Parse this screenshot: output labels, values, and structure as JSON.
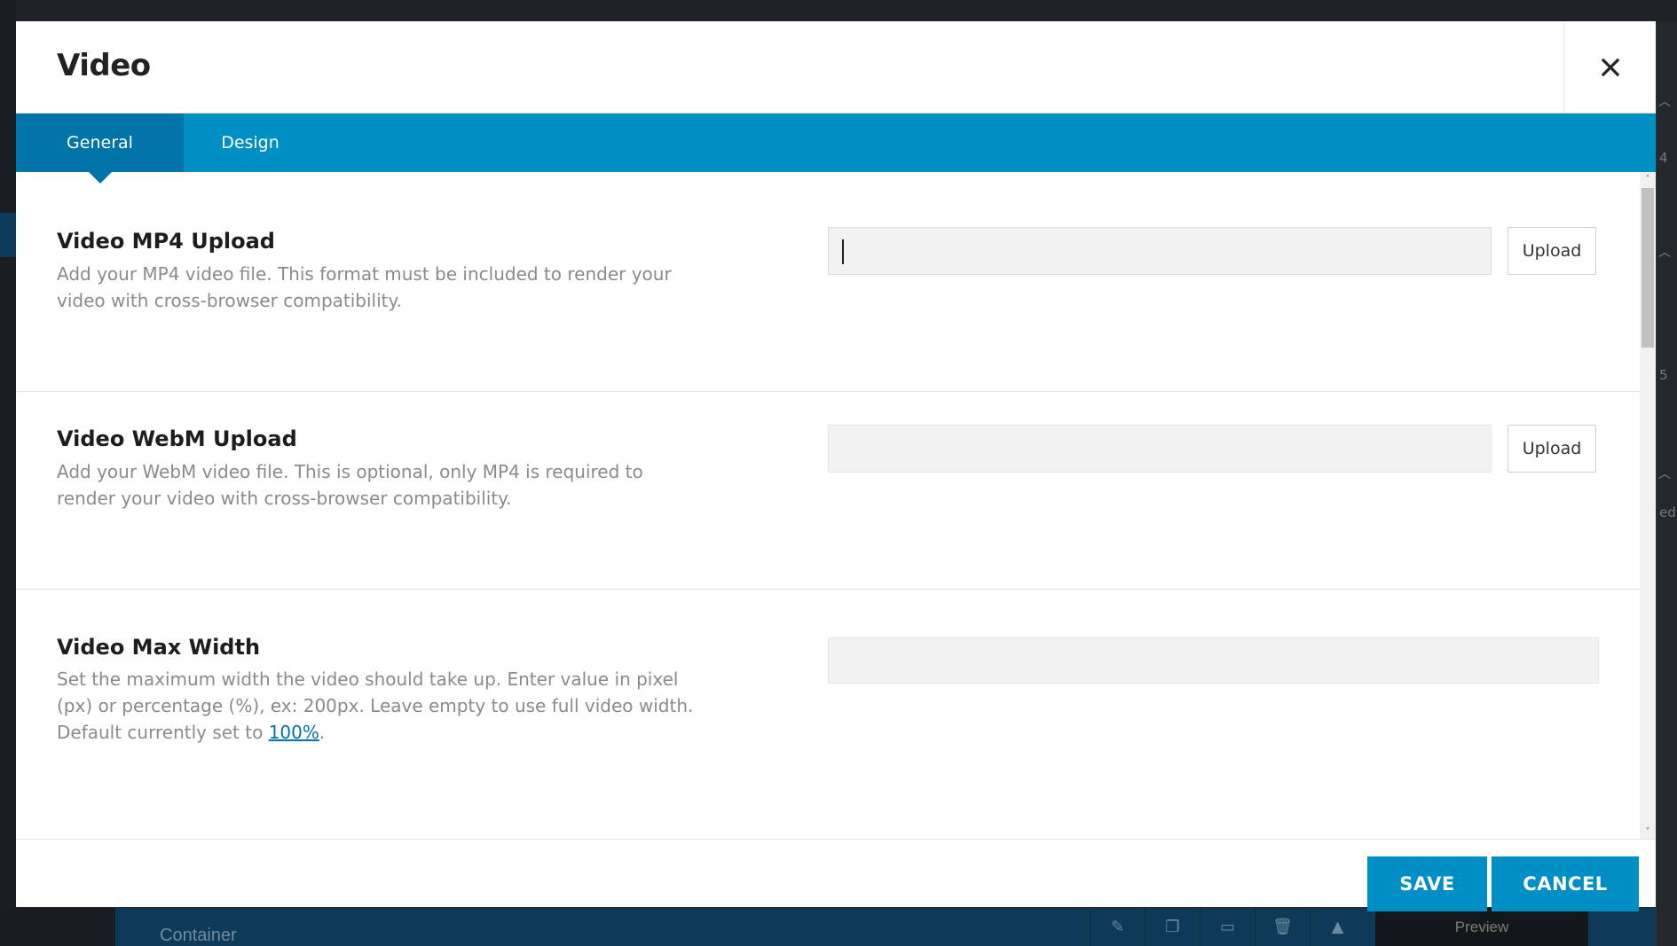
{
  "background": {
    "container_label": "Container",
    "preview_label": "Preview",
    "side_numbers": [
      "4",
      "5"
    ],
    "side_fragment": "ed",
    "tool_icons": [
      "pencil-icon",
      "copy-icon",
      "save-icon",
      "trash-icon",
      "arrow-up-icon"
    ]
  },
  "modal": {
    "title": "Video",
    "close_icon": "close-icon",
    "tabs": [
      {
        "label": "General",
        "active": true
      },
      {
        "label": "Design",
        "active": false
      }
    ],
    "fields": [
      {
        "title": "Video MP4 Upload",
        "description": "Add your MP4 video file. This format must be included to render your video with cross-browser compatibility.",
        "value": "",
        "button_label": "Upload"
      },
      {
        "title": "Video WebM Upload",
        "description": "Add your WebM video file. This is optional, only MP4 is required to render your video with cross-browser compatibility.",
        "value": "",
        "button_label": "Upload"
      },
      {
        "title": "Video Max Width",
        "description_prefix": "Set the maximum width the video should take up. Enter value in pixel (px) or percentage (%), ex: 200px. Leave empty to use full video width. Default currently set to ",
        "description_link": "100%",
        "description_suffix": ".",
        "value": ""
      }
    ],
    "footer": {
      "save_label": "SAVE",
      "cancel_label": "CANCEL"
    }
  },
  "colors": {
    "accent": "#008fc5",
    "accent_dark": "#0074a8",
    "link": "#0073aa"
  }
}
